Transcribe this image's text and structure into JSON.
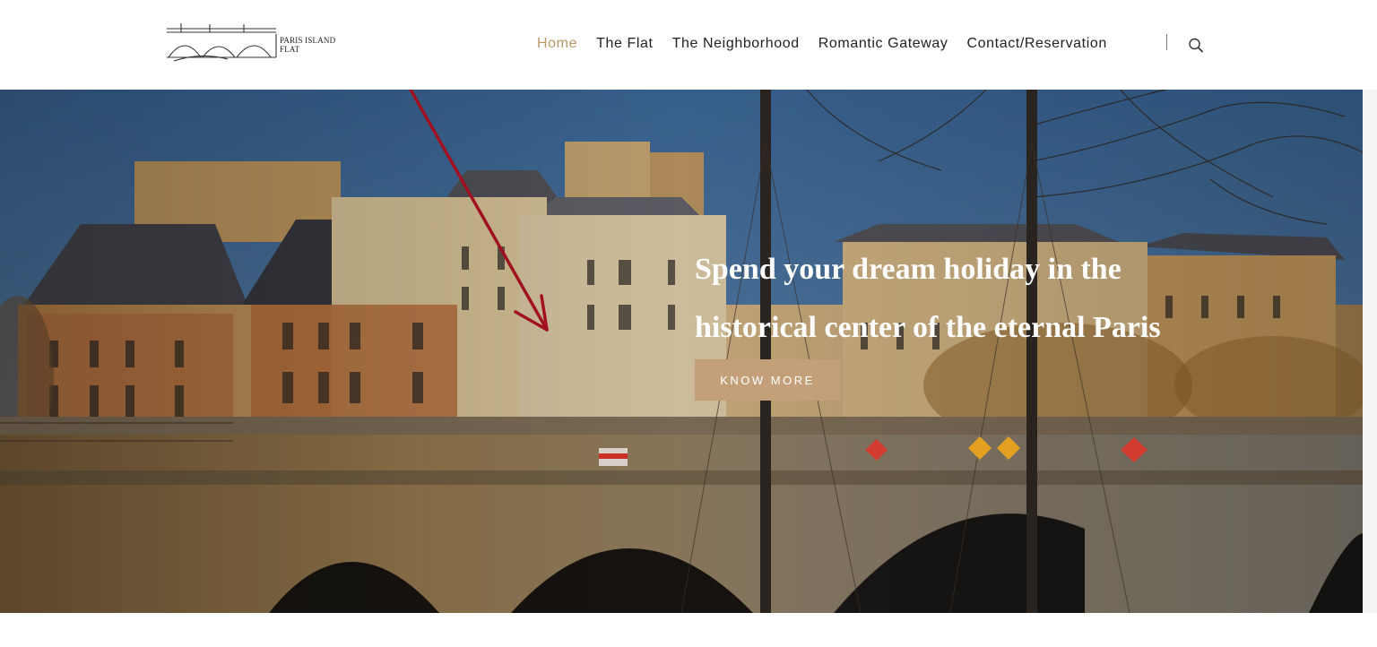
{
  "brand": {
    "logo_line1": "PARIS ISLAND",
    "logo_line2": "FLAT"
  },
  "nav": {
    "items": [
      {
        "label": "Home",
        "active": true
      },
      {
        "label": "The Flat",
        "active": false
      },
      {
        "label": "The Neighborhood",
        "active": false
      },
      {
        "label": "Romantic Gateway",
        "active": false
      },
      {
        "label": "Contact/Reservation",
        "active": false
      }
    ]
  },
  "hero": {
    "title_line1": "Spend your dream holiday in the",
    "title_line2": "historical center of the eternal Paris",
    "button_label": "KNOW MORE"
  },
  "colors": {
    "accent": "#b8976a",
    "button_bg": "#c4a07a",
    "text_dark": "#222222",
    "arrow": "#a01020"
  },
  "icons": {
    "search": "search-icon"
  }
}
